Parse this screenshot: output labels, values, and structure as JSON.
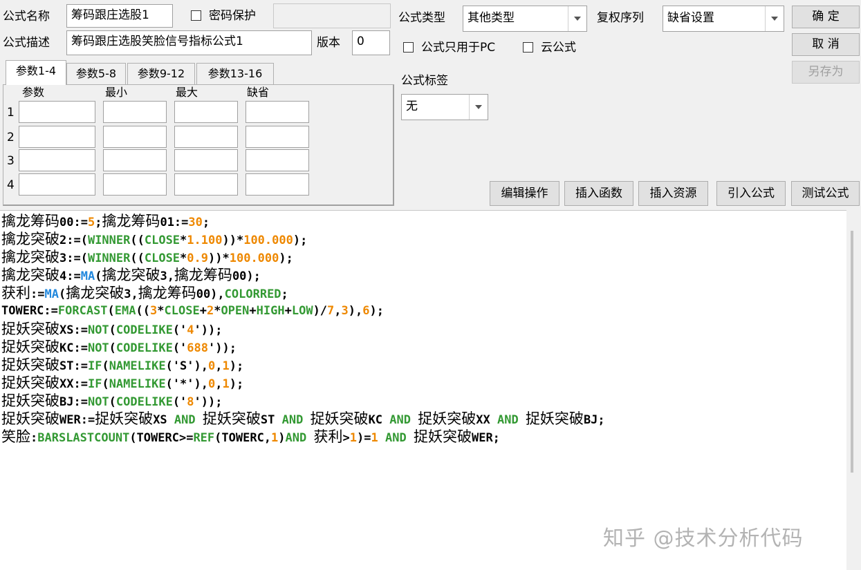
{
  "header": {
    "name_label": "公式名称",
    "name_value": "筹码跟庄选股1",
    "password_label": "密码保护",
    "password_value": "",
    "desc_label": "公式描述",
    "desc_value": "筹码跟庄选股笑脸信号指标公式1",
    "version_label": "版本",
    "version_value": "0",
    "type_label": "公式类型",
    "type_value": "其他类型",
    "fq_label": "复权序列",
    "fq_value": "缺省设置",
    "pc_only_label": "公式只用于PC",
    "cloud_label": "云公式",
    "tag_label": "公式标签",
    "tag_value": "无"
  },
  "buttons": {
    "ok": "确  定",
    "cancel": "取  消",
    "save_as": "另存为",
    "edit_ops": "编辑操作",
    "insert_func": "插入函数",
    "insert_res": "插入资源",
    "import_formula": "引入公式",
    "test_formula": "测试公式"
  },
  "params": {
    "tabs": [
      "参数1-4",
      "参数5-8",
      "参数9-12",
      "参数13-16"
    ],
    "active_tab": 0,
    "columns": [
      "参数",
      "最小",
      "最大",
      "缺省"
    ],
    "rows": [
      "1",
      "2",
      "3",
      "4"
    ]
  },
  "code_lines": [
    [
      [
        "c",
        "擒龙筹码"
      ],
      [
        "t",
        "00:="
      ],
      [
        "n",
        "5"
      ],
      [
        "t",
        ";"
      ],
      [
        "c",
        "擒龙筹码"
      ],
      [
        "t",
        "01:="
      ],
      [
        "n",
        "30"
      ],
      [
        "t",
        ";"
      ]
    ],
    [
      [
        "c",
        "擒龙突破"
      ],
      [
        "t",
        "2:=("
      ],
      [
        "k",
        "WINNER"
      ],
      [
        "t",
        "(("
      ],
      [
        "k",
        "CLOSE"
      ],
      [
        "t",
        "*"
      ],
      [
        "n",
        "1.100"
      ],
      [
        "t",
        "))*"
      ],
      [
        "n",
        "100.000"
      ],
      [
        "t",
        ");"
      ]
    ],
    [
      [
        "c",
        "擒龙突破"
      ],
      [
        "t",
        "3:=("
      ],
      [
        "k",
        "WINNER"
      ],
      [
        "t",
        "(("
      ],
      [
        "k",
        "CLOSE"
      ],
      [
        "t",
        "*"
      ],
      [
        "n",
        "0.9"
      ],
      [
        "t",
        "))*"
      ],
      [
        "n",
        "100.000"
      ],
      [
        "t",
        ");"
      ]
    ],
    [
      [
        "c",
        "擒龙突破"
      ],
      [
        "t",
        "4:="
      ],
      [
        "f",
        "MA"
      ],
      [
        "t",
        "("
      ],
      [
        "c",
        "擒龙突破"
      ],
      [
        "t",
        "3,"
      ],
      [
        "c",
        "擒龙筹码"
      ],
      [
        "t",
        "00);"
      ]
    ],
    [
      [
        "c",
        "获利"
      ],
      [
        "t",
        ":="
      ],
      [
        "f",
        "MA"
      ],
      [
        "t",
        "("
      ],
      [
        "c",
        "擒龙突破"
      ],
      [
        "t",
        "3,"
      ],
      [
        "c",
        "擒龙筹码"
      ],
      [
        "t",
        "00),"
      ],
      [
        "k",
        "COLORRED"
      ],
      [
        "t",
        ";"
      ]
    ],
    [
      [
        "t",
        "TOWERC:="
      ],
      [
        "k",
        "FORCAST"
      ],
      [
        "t",
        "("
      ],
      [
        "k",
        "EMA"
      ],
      [
        "t",
        "(("
      ],
      [
        "n",
        "3"
      ],
      [
        "t",
        "*"
      ],
      [
        "k",
        "CLOSE"
      ],
      [
        "t",
        "+"
      ],
      [
        "n",
        "2"
      ],
      [
        "t",
        "*"
      ],
      [
        "k",
        "OPEN"
      ],
      [
        "t",
        "+"
      ],
      [
        "k",
        "HIGH"
      ],
      [
        "t",
        "+"
      ],
      [
        "k",
        "LOW"
      ],
      [
        "t",
        ")/"
      ],
      [
        "n",
        "7"
      ],
      [
        "t",
        ","
      ],
      [
        "n",
        "3"
      ],
      [
        "t",
        "),"
      ],
      [
        "n",
        "6"
      ],
      [
        "t",
        ");"
      ]
    ],
    [
      [
        "c",
        "捉妖突破"
      ],
      [
        "t",
        "XS:="
      ],
      [
        "k",
        "NOT"
      ],
      [
        "t",
        "("
      ],
      [
        "k",
        "CODELIKE"
      ],
      [
        "t",
        "('"
      ],
      [
        "n",
        "4"
      ],
      [
        "t",
        "'));"
      ]
    ],
    [
      [
        "c",
        "捉妖突破"
      ],
      [
        "t",
        "KC:="
      ],
      [
        "k",
        "NOT"
      ],
      [
        "t",
        "("
      ],
      [
        "k",
        "CODELIKE"
      ],
      [
        "t",
        "('"
      ],
      [
        "n",
        "688"
      ],
      [
        "t",
        "'));"
      ]
    ],
    [
      [
        "c",
        "捉妖突破"
      ],
      [
        "t",
        "ST:="
      ],
      [
        "k",
        "IF"
      ],
      [
        "t",
        "("
      ],
      [
        "k",
        "NAMELIKE"
      ],
      [
        "t",
        "('S'),"
      ],
      [
        "n",
        "0"
      ],
      [
        "t",
        ","
      ],
      [
        "n",
        "1"
      ],
      [
        "t",
        ");"
      ]
    ],
    [
      [
        "c",
        "捉妖突破"
      ],
      [
        "t",
        "XX:="
      ],
      [
        "k",
        "IF"
      ],
      [
        "t",
        "("
      ],
      [
        "k",
        "NAMELIKE"
      ],
      [
        "t",
        "('*'),"
      ],
      [
        "n",
        "0"
      ],
      [
        "t",
        ","
      ],
      [
        "n",
        "1"
      ],
      [
        "t",
        ");"
      ]
    ],
    [
      [
        "c",
        "捉妖突破"
      ],
      [
        "t",
        "BJ:="
      ],
      [
        "k",
        "NOT"
      ],
      [
        "t",
        "("
      ],
      [
        "k",
        "CODELIKE"
      ],
      [
        "t",
        "('"
      ],
      [
        "n",
        "8"
      ],
      [
        "t",
        "'));"
      ]
    ],
    [
      [
        "c",
        "捉妖突破"
      ],
      [
        "t",
        "WER:="
      ],
      [
        "c",
        "捉妖突破"
      ],
      [
        "t",
        "XS "
      ],
      [
        "k",
        "AND"
      ],
      [
        "t",
        " "
      ],
      [
        "c",
        "捉妖突破"
      ],
      [
        "t",
        "ST "
      ],
      [
        "k",
        "AND"
      ],
      [
        "t",
        " "
      ],
      [
        "c",
        "捉妖突破"
      ],
      [
        "t",
        "KC "
      ],
      [
        "k",
        "AND"
      ],
      [
        "t",
        " "
      ],
      [
        "c",
        "捉妖突破"
      ],
      [
        "t",
        "XX "
      ],
      [
        "k",
        "AND"
      ],
      [
        "t",
        " "
      ],
      [
        "c",
        "捉妖突破"
      ],
      [
        "t",
        "BJ;"
      ]
    ],
    [
      [
        "c",
        "笑脸"
      ],
      [
        "t",
        ":"
      ],
      [
        "k",
        "BARSLASTCOUNT"
      ],
      [
        "t",
        "(TOWERC>="
      ],
      [
        "k",
        "REF"
      ],
      [
        "t",
        "(TOWERC,"
      ],
      [
        "n",
        "1"
      ],
      [
        "t",
        ")"
      ],
      [
        "k",
        "AND"
      ],
      [
        "t",
        " "
      ],
      [
        "c",
        "获利"
      ],
      [
        "t",
        ">"
      ],
      [
        "n",
        "1"
      ],
      [
        "t",
        ")="
      ],
      [
        "n",
        "1"
      ],
      [
        "t",
        " "
      ],
      [
        "k",
        "AND"
      ],
      [
        "t",
        " "
      ],
      [
        "c",
        "捉妖突破"
      ],
      [
        "t",
        "WER;"
      ]
    ]
  ],
  "watermark": "知乎 @技术分析代码",
  "colors": {
    "keyword": "#339933",
    "number": "#ee8800",
    "function": "#2288dd"
  }
}
